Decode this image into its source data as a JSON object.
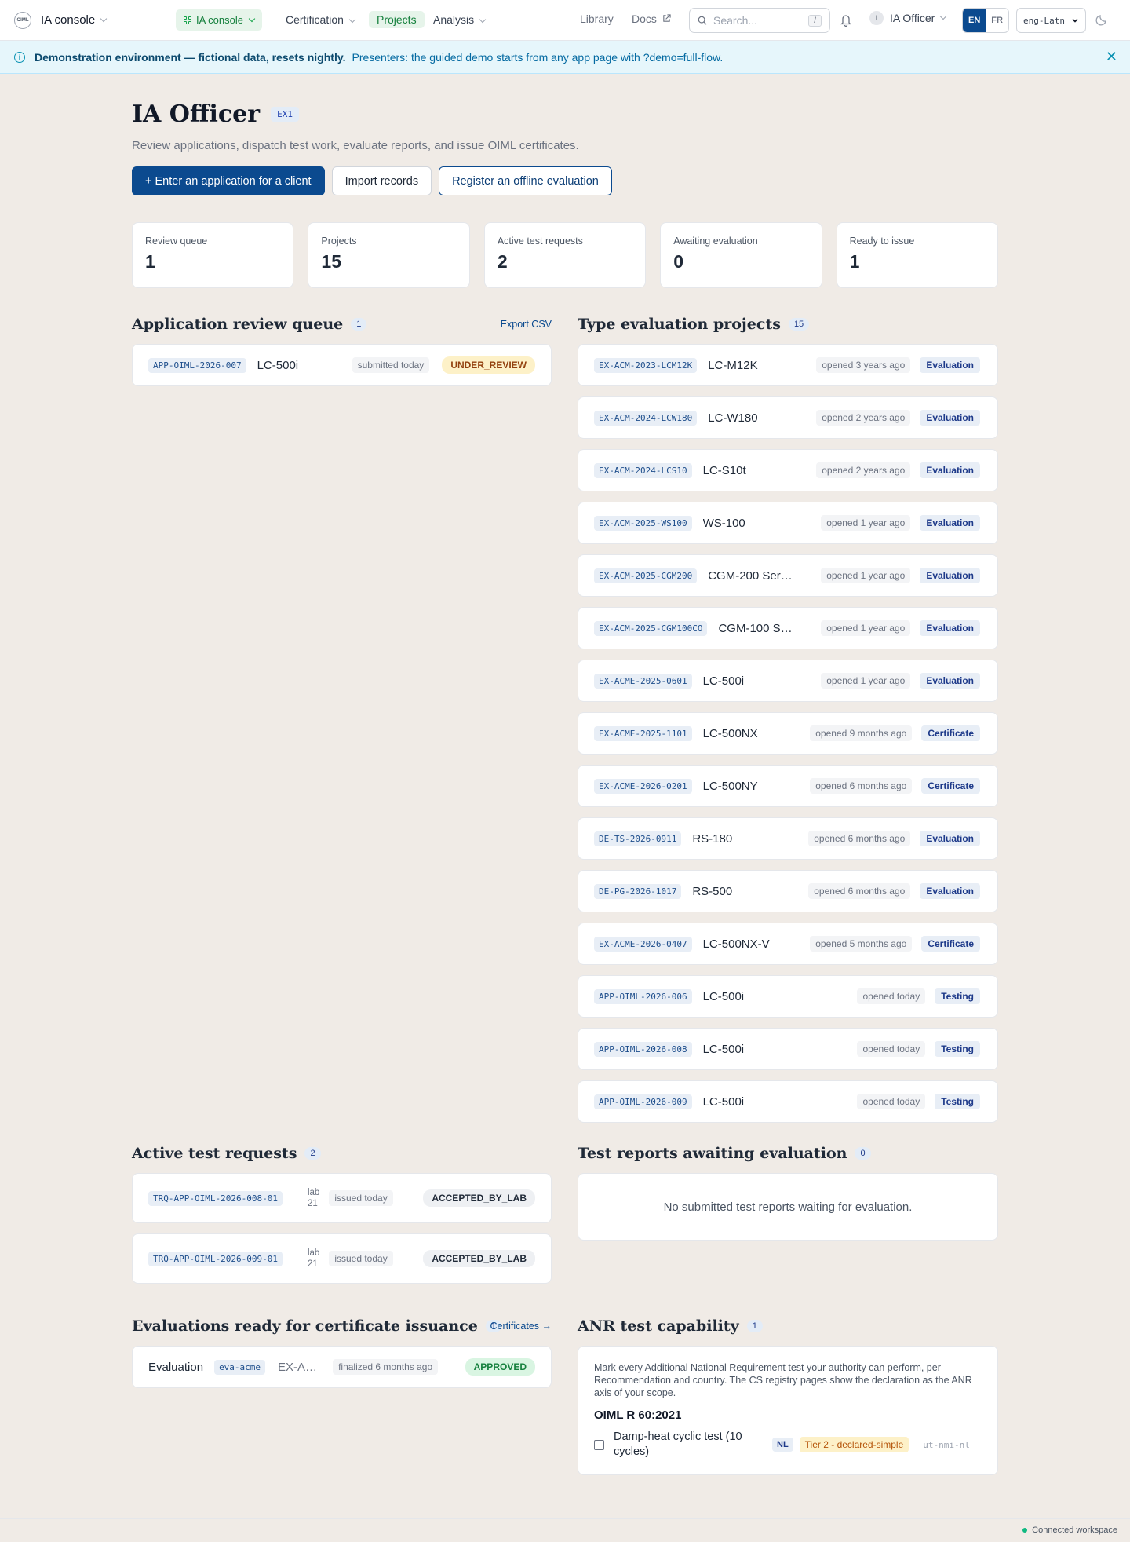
{
  "header": {
    "app_name": "IA console",
    "console_pill": "IA console",
    "nav": [
      "Certification",
      "Projects",
      "Analysis"
    ],
    "active_nav": "Projects",
    "library": "Library",
    "docs": "Docs",
    "search_placeholder": "Search...",
    "search_shortcut": "/",
    "user_initial": "I",
    "user_name": "IA Officer",
    "lang_en": "EN",
    "lang_fr": "FR",
    "script": "eng-Latn",
    "logo_text": "OIML"
  },
  "banner": {
    "bold": "Demonstration environment — fictional data, resets nightly.",
    "note": "Presenters: the guided demo starts from any app page with ?demo=full-flow."
  },
  "page": {
    "title": "IA Officer",
    "badge": "EX1",
    "subtitle": "Review applications, dispatch test work, evaluate reports, and issue OIML certificates.",
    "actions": {
      "enter": "+ Enter an application for a client",
      "import": "Import records",
      "register": "Register an offline evaluation"
    }
  },
  "stats": [
    {
      "label": "Review queue",
      "value": "1"
    },
    {
      "label": "Projects",
      "value": "15"
    },
    {
      "label": "Active test requests",
      "value": "2"
    },
    {
      "label": "Awaiting evaluation",
      "value": "0"
    },
    {
      "label": "Ready to issue",
      "value": "1"
    }
  ],
  "review_queue": {
    "title": "Application review queue",
    "count": "1",
    "export": "Export CSV",
    "items": [
      {
        "code": "APP-OIML-2026-007",
        "model": "LC-500i",
        "time": "submitted today",
        "status": "UNDER_REVIEW"
      }
    ]
  },
  "projects": {
    "title": "Type evaluation projects",
    "count": "15",
    "items": [
      {
        "code": "EX-ACM-2023-LCM12K",
        "model": "LC-M12K",
        "time": "opened 3 years ago",
        "tag": "Evaluation"
      },
      {
        "code": "EX-ACM-2024-LCW180",
        "model": "LC-W180",
        "time": "opened 2 years ago",
        "tag": "Evaluation"
      },
      {
        "code": "EX-ACM-2024-LCS10",
        "model": "LC-S10t",
        "time": "opened 2 years ago",
        "tag": "Evaluation"
      },
      {
        "code": "EX-ACM-2025-WS100",
        "model": "WS-100",
        "time": "opened 1 year ago",
        "tag": "Evaluation"
      },
      {
        "code": "EX-ACM-2025-CGM200",
        "model": "CGM-200 Ser…",
        "time": "opened 1 year ago",
        "tag": "Evaluation"
      },
      {
        "code": "EX-ACM-2025-CGM100CO",
        "model": "CGM-100 S…",
        "time": "opened 1 year ago",
        "tag": "Evaluation"
      },
      {
        "code": "EX-ACME-2025-0601",
        "model": "LC-500i",
        "time": "opened 1 year ago",
        "tag": "Evaluation"
      },
      {
        "code": "EX-ACME-2025-1101",
        "model": "LC-500NX",
        "time": "opened 9 months ago",
        "tag": "Certificate"
      },
      {
        "code": "EX-ACME-2026-0201",
        "model": "LC-500NY",
        "time": "opened 6 months ago",
        "tag": "Certificate"
      },
      {
        "code": "DE-TS-2026-0911",
        "model": "RS-180",
        "time": "opened 6 months ago",
        "tag": "Evaluation"
      },
      {
        "code": "DE-PG-2026-1017",
        "model": "RS-500",
        "time": "opened 6 months ago",
        "tag": "Evaluation"
      },
      {
        "code": "EX-ACME-2026-0407",
        "model": "LC-500NX-V",
        "time": "opened 5 months ago",
        "tag": "Certificate"
      },
      {
        "code": "APP-OIML-2026-006",
        "model": "LC-500i",
        "time": "opened today",
        "tag": "Testing"
      },
      {
        "code": "APP-OIML-2026-008",
        "model": "LC-500i",
        "time": "opened today",
        "tag": "Testing"
      },
      {
        "code": "APP-OIML-2026-009",
        "model": "LC-500i",
        "time": "opened today",
        "tag": "Testing"
      }
    ]
  },
  "test_requests": {
    "title": "Active test requests",
    "count": "2",
    "items": [
      {
        "code": "TRQ-APP-OIML-2026-008-01",
        "lab1": "lab",
        "lab2": "21",
        "time": "issued today",
        "status": "ACCEPTED_BY_LAB"
      },
      {
        "code": "TRQ-APP-OIML-2026-009-01",
        "lab1": "lab",
        "lab2": "21",
        "time": "issued today",
        "status": "ACCEPTED_BY_LAB"
      }
    ]
  },
  "reports": {
    "title": "Test reports awaiting evaluation",
    "count": "0",
    "empty": "No submitted test reports waiting for evaluation."
  },
  "ready": {
    "title": "Evaluations ready for certificate issuance",
    "count": "1",
    "link": "Certificates →",
    "item": {
      "label": "Evaluation",
      "code": "eva-acme",
      "ref": "EX-A…",
      "time": "finalized 6 months ago",
      "status": "APPROVED"
    }
  },
  "anr": {
    "title": "ANR test capability",
    "count": "1",
    "description": "Mark every Additional National Requirement test your authority can perform, per Recommendation and country. The CS registry pages show the declaration as the ANR axis of your scope.",
    "recommendation": "OIML R 60:2021",
    "test": "Damp-heat cyclic test (10 cycles)",
    "country": "NL",
    "tier": "Tier 2 - declared-simple",
    "urn": "ut-nmi-nl"
  },
  "footer": {
    "status": "Connected workspace"
  },
  "colors": {
    "primary": "#0b4a8f",
    "active_green": "#15803d",
    "background": "#f0ebe6"
  }
}
